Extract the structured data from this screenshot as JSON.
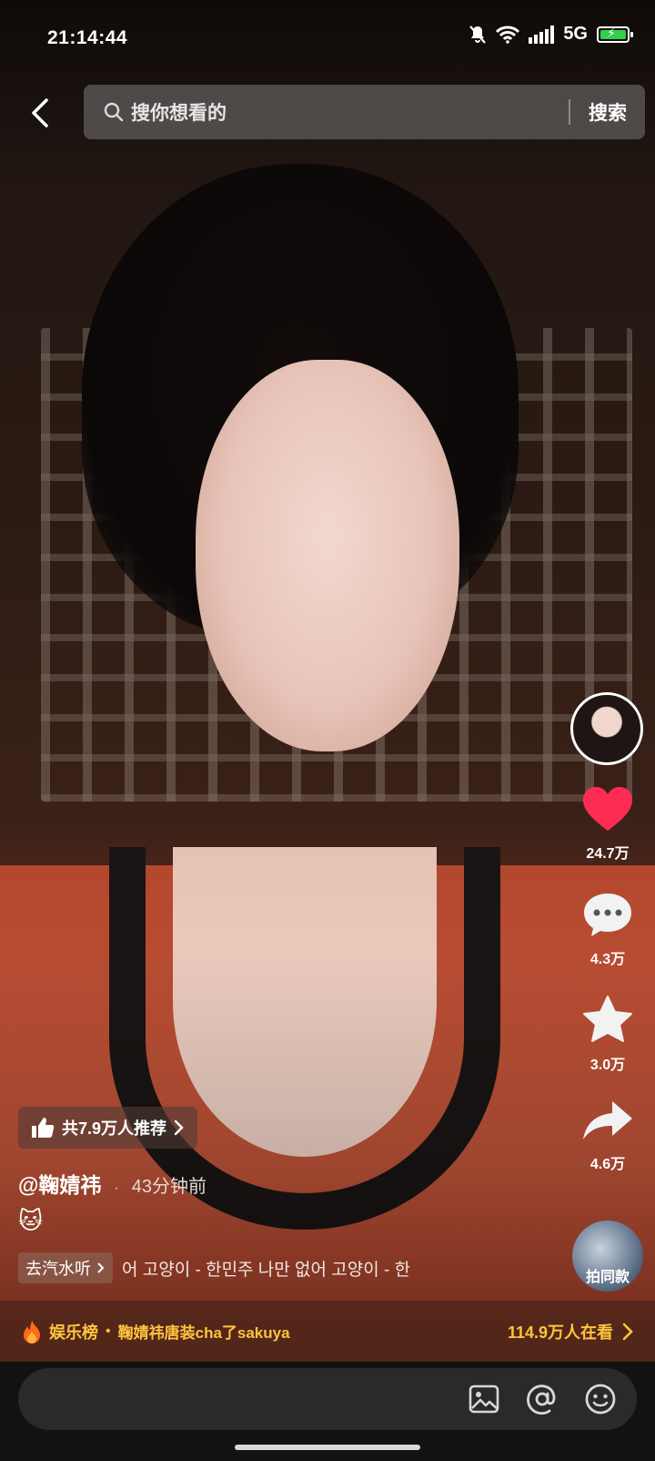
{
  "status_bar": {
    "time": "21:14:44",
    "network": "5G",
    "icons": [
      "mute-icon",
      "wifi-icon",
      "signal-icon",
      "battery-charging-icon"
    ],
    "battery_color": "#2fd04a"
  },
  "search": {
    "placeholder": "搜你想看的",
    "button": "搜索",
    "back_icon": "chevron-left-icon"
  },
  "rail": {
    "like_count": "24.7万",
    "comment_count": "4.3万",
    "favorite_count": "3.0万",
    "share_count": "4.6万",
    "same_style_label": "拍同款",
    "like_color": "#fe2c55"
  },
  "video_info": {
    "recommend_text": "共7.9万人推荐",
    "author": "@鞠婧祎",
    "time_ago": "43分钟前",
    "caption_emoji": "🐱",
    "music_pill": "去汽水听",
    "music_title": "어 고양이 - 한민주     나만 없어 고양이 - 한"
  },
  "hot_bar": {
    "label": "娱乐榜",
    "separator": "•",
    "topic": "鞠婧祎唐装cha了sakuya",
    "watching": "114.9万人在看",
    "accent": "#ffc53d"
  },
  "comment_bar": {
    "placeholder": "",
    "icons": [
      "image-icon",
      "at-icon",
      "emoji-icon"
    ]
  }
}
